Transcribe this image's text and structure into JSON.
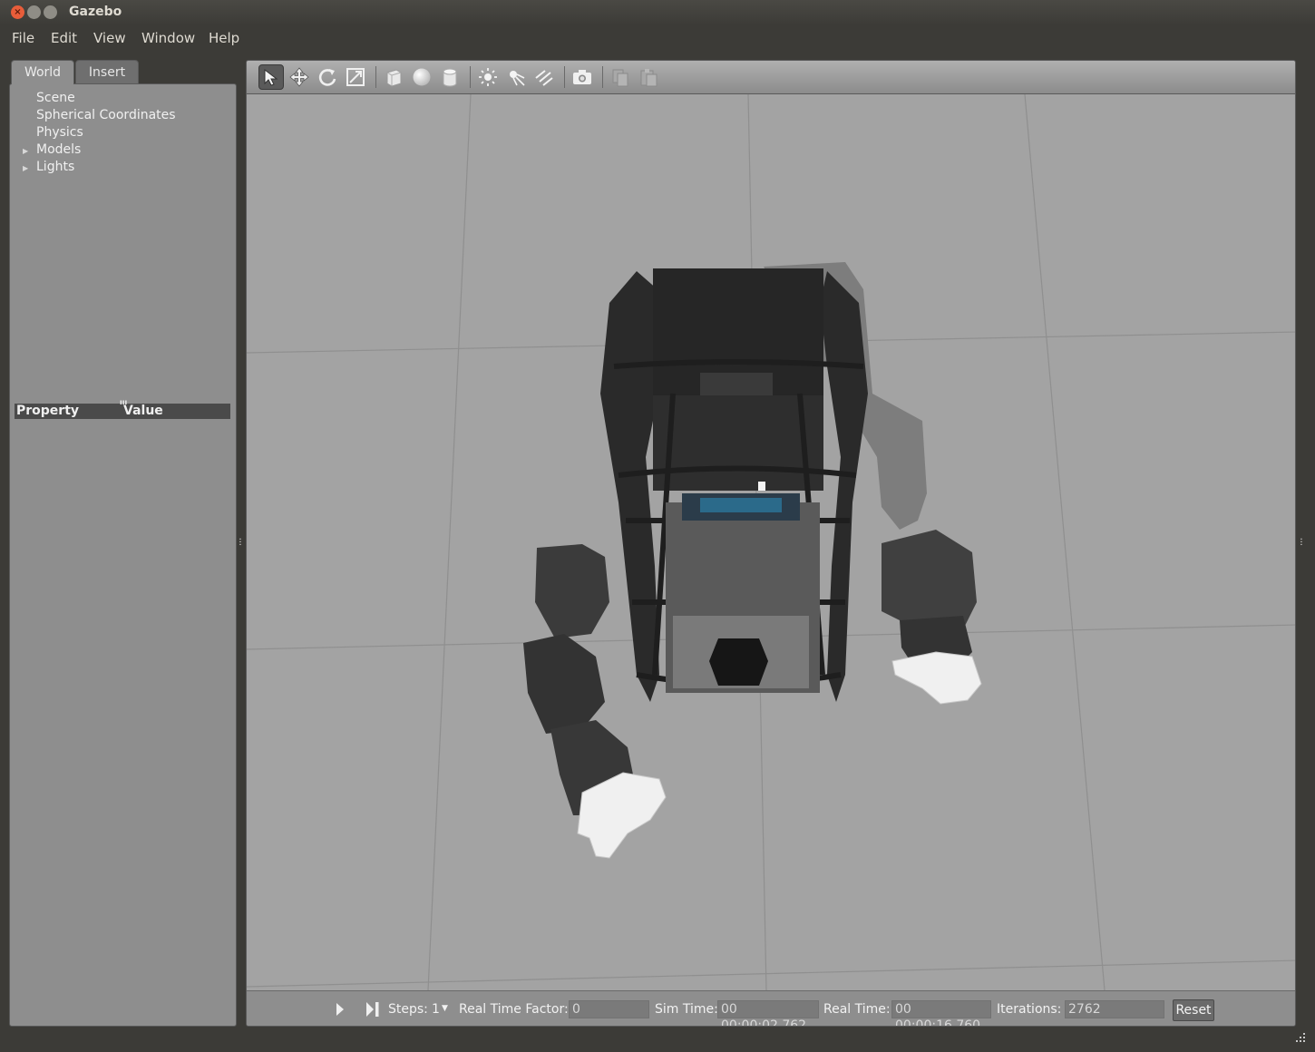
{
  "window": {
    "title": "Gazebo"
  },
  "menu": [
    "File",
    "Edit",
    "View",
    "Window",
    "Help"
  ],
  "left_panel": {
    "tabs": {
      "world": "World",
      "insert": "Insert"
    },
    "tree": [
      "Scene",
      "Spherical Coordinates",
      "Physics",
      "Models",
      "Lights"
    ],
    "property_header": {
      "property": "Property",
      "value": "Value"
    }
  },
  "toolbar_icons": [
    "select-mode-icon",
    "translate-mode-icon",
    "rotate-mode-icon",
    "scale-mode-icon",
    "box-icon",
    "sphere-icon",
    "cylinder-icon",
    "point-light-icon",
    "spot-light-icon",
    "directional-light-icon",
    "screenshot-icon",
    "copy-icon",
    "paste-icon"
  ],
  "status": {
    "steps_label": "Steps:",
    "steps_value": "1",
    "rtf_label": "Real Time Factor:",
    "rtf_value": "0",
    "sim_time_label": "Sim Time:",
    "sim_time_value": "00 00:00:02.762",
    "real_time_label": "Real Time:",
    "real_time_value": "00 00:00:16.760",
    "iterations_label": "Iterations:",
    "iterations_value": "2762",
    "reset_label": "Reset"
  },
  "colors": {
    "ground": "#a3a3a3",
    "panel": "#8e8e8e",
    "chrome": "#3c3b37",
    "close_button": "#e85d3a"
  }
}
